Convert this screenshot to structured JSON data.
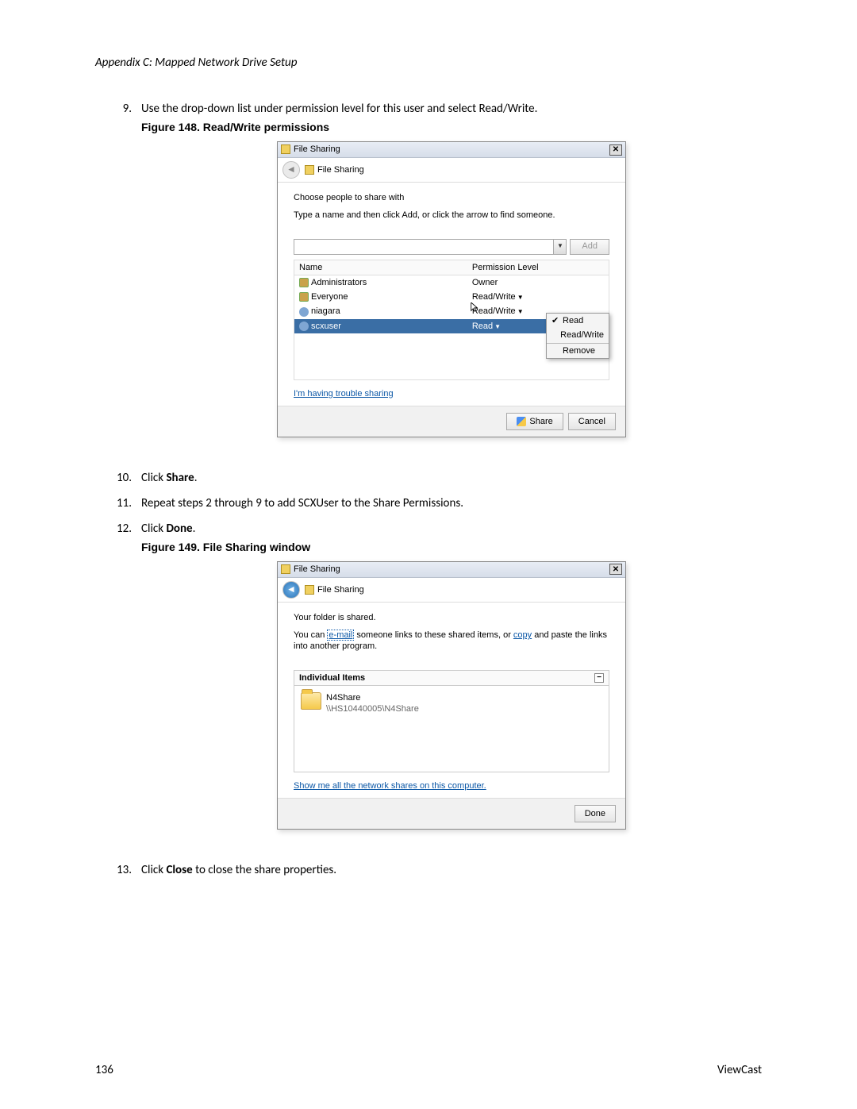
{
  "header": "Appendix C: Mapped Network Drive Setup",
  "steps": {
    "s9_num": "9.",
    "s9_text": "Use the drop-down list under permission level for this user and select Read/Write.",
    "s10_num": "10.",
    "s10_pre": "Click ",
    "s10_bold": "Share",
    "s10_post": ".",
    "s11_num": "11.",
    "s11_text": "Repeat steps 2 through 9 to add SCXUser to the Share Permissions.",
    "s12_num": "12.",
    "s12_pre": "Click ",
    "s12_bold": "Done",
    "s12_post": ".",
    "s13_num": "13.",
    "s13_pre": "Click ",
    "s13_bold": "Close",
    "s13_post": " to close the share properties."
  },
  "fig148": {
    "caption": "Figure 148. Read/Write permissions",
    "title": "File Sharing",
    "breadcrumb": "File Sharing",
    "h1": "Choose people to share with",
    "h2": "Type a name and then click Add, or click the arrow to find someone.",
    "add_btn": "Add",
    "col_name": "Name",
    "col_perm": "Permission Level",
    "rows": [
      {
        "name": "Administrators",
        "perm": "Owner",
        "icon": "grp",
        "drop": false
      },
      {
        "name": "Everyone",
        "perm": "Read/Write",
        "icon": "grp",
        "drop": true
      },
      {
        "name": "niagara",
        "perm": "Read/Write",
        "icon": "usr",
        "drop": true
      },
      {
        "name": "scxuser",
        "perm": "Read",
        "icon": "usr",
        "drop": true,
        "sel": true
      }
    ],
    "menu": {
      "read": "Read",
      "rw": "Read/Write",
      "remove": "Remove"
    },
    "trouble_link": "I'm having trouble sharing",
    "share_btn": "Share",
    "cancel_btn": "Cancel"
  },
  "fig149": {
    "caption": "Figure 149. File Sharing window",
    "title": "File Sharing",
    "breadcrumb": "File Sharing",
    "h1": "Your folder is shared.",
    "h2a": "You can ",
    "h2_email": "e-mail",
    "h2b": " someone links to these shared items, or ",
    "h2_copy": "copy",
    "h2c": " and paste the links into another program.",
    "items_header": "Individual Items",
    "folder_name": "N4Share",
    "folder_path": "\\\\HS10440005\\N4Share",
    "shares_link": "Show me all the network shares on this computer.",
    "done_btn": "Done"
  },
  "footer": {
    "page": "136",
    "brand": "ViewCast"
  }
}
